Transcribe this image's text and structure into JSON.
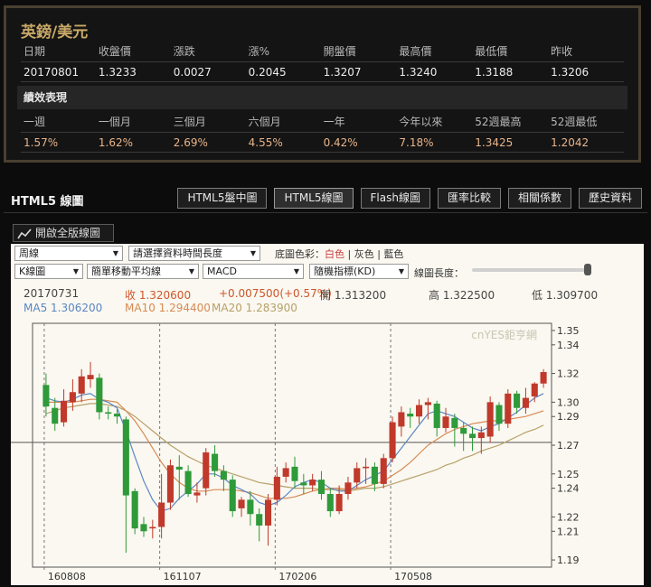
{
  "quote": {
    "title": "英鎊/美元",
    "headers": [
      "日期",
      "收盤價",
      "漲跌",
      "漲%",
      "開盤價",
      "最高價",
      "最低價",
      "昨收"
    ],
    "values": [
      "20170801",
      "1.3233",
      "0.0027",
      "0.2045",
      "1.3207",
      "1.3240",
      "1.3188",
      "1.3206"
    ],
    "perf_title": "績效表現",
    "perf_headers": [
      "一週",
      "一個月",
      "三個月",
      "六個月",
      "一年",
      "今年以來",
      "52週最高",
      "52週最低"
    ],
    "perf_values": [
      "1.57%",
      "1.62%",
      "2.69%",
      "4.55%",
      "0.42%",
      "7.18%",
      "1.3425",
      "1.2042"
    ]
  },
  "section": {
    "title": "HTML5 線圖",
    "tabs": [
      "HTML5盤中圖",
      "HTML5線圖",
      "Flash線圖",
      "匯率比較",
      "相關係數",
      "歷史資料"
    ],
    "active_tab": "HTML5線圖"
  },
  "full_version_label": "開啟全版線圖",
  "controls": {
    "period": "周線",
    "time_length": "請選擇資料時間長度",
    "bg_label": "底圖色彩：",
    "bg_white": "白色",
    "bg_sep1": "|",
    "bg_gray": "灰色",
    "bg_sep2": "|",
    "bg_blue": "藍色",
    "chart_type": "K線圖",
    "ma_type": "簡單移動平均線",
    "indicator1": "MACD",
    "indicator2": "隨機指標(KD)",
    "length_label": "線圖長度："
  },
  "info": {
    "date": "20170731",
    "close": "收 1.320600",
    "change": "+0.007500(+0.57%)",
    "open": "開 1.313200",
    "high": "高 1.322500",
    "low": "低 1.309700",
    "ma5": "MA5 1.306200",
    "ma10": "MA10 1.294400",
    "ma20": "MA20 1.283900"
  },
  "watermark": "cnYES鉅亨網",
  "colors": {
    "up": "#c0392b",
    "down": "#2e9a3a",
    "ma5": "#5b86c4",
    "ma10": "#d88a55",
    "ma20": "#b8a06a",
    "gold": "#c8a867"
  },
  "chart_data": {
    "type": "candlestick",
    "x_ticks": [
      "160808",
      "161107",
      "170206",
      "170508"
    ],
    "y_ticks": [
      1.35,
      1.34,
      1.32,
      1.3,
      1.29,
      1.27,
      1.25,
      1.24,
      1.22,
      1.21,
      1.19
    ],
    "ylim": [
      1.185,
      1.355
    ],
    "reference_line": 1.272,
    "candles": [
      {
        "o": 1.312,
        "c": 1.297,
        "h": 1.32,
        "l": 1.29
      },
      {
        "o": 1.296,
        "c": 1.285,
        "h": 1.303,
        "l": 1.28
      },
      {
        "o": 1.286,
        "c": 1.301,
        "h": 1.309,
        "l": 1.283
      },
      {
        "o": 1.3,
        "c": 1.307,
        "h": 1.316,
        "l": 1.294
      },
      {
        "o": 1.306,
        "c": 1.318,
        "h": 1.323,
        "l": 1.3
      },
      {
        "o": 1.316,
        "c": 1.319,
        "h": 1.328,
        "l": 1.31
      },
      {
        "o": 1.317,
        "c": 1.293,
        "h": 1.32,
        "l": 1.288
      },
      {
        "o": 1.293,
        "c": 1.292,
        "h": 1.297,
        "l": 1.288
      },
      {
        "o": 1.292,
        "c": 1.29,
        "h": 1.295,
        "l": 1.285
      },
      {
        "o": 1.288,
        "c": 1.235,
        "h": 1.29,
        "l": 1.195
      },
      {
        "o": 1.238,
        "c": 1.212,
        "h": 1.24,
        "l": 1.208
      },
      {
        "o": 1.215,
        "c": 1.21,
        "h": 1.22,
        "l": 1.206
      },
      {
        "o": 1.212,
        "c": 1.213,
        "h": 1.218,
        "l": 1.205
      },
      {
        "o": 1.213,
        "c": 1.23,
        "h": 1.25,
        "l": 1.205
      },
      {
        "o": 1.23,
        "c": 1.256,
        "h": 1.26,
        "l": 1.225
      },
      {
        "o": 1.255,
        "c": 1.253,
        "h": 1.263,
        "l": 1.232
      },
      {
        "o": 1.252,
        "c": 1.236,
        "h": 1.256,
        "l": 1.234
      },
      {
        "o": 1.235,
        "c": 1.237,
        "h": 1.244,
        "l": 1.23
      },
      {
        "o": 1.24,
        "c": 1.265,
        "h": 1.268,
        "l": 1.235
      },
      {
        "o": 1.264,
        "c": 1.252,
        "h": 1.27,
        "l": 1.248
      },
      {
        "o": 1.252,
        "c": 1.246,
        "h": 1.256,
        "l": 1.238
      },
      {
        "o": 1.246,
        "c": 1.224,
        "h": 1.249,
        "l": 1.22
      },
      {
        "o": 1.226,
        "c": 1.232,
        "h": 1.234,
        "l": 1.22
      },
      {
        "o": 1.232,
        "c": 1.222,
        "h": 1.238,
        "l": 1.214
      },
      {
        "o": 1.222,
        "c": 1.214,
        "h": 1.226,
        "l": 1.203
      },
      {
        "o": 1.214,
        "c": 1.232,
        "h": 1.236,
        "l": 1.2
      },
      {
        "o": 1.232,
        "c": 1.248,
        "h": 1.255,
        "l": 1.228
      },
      {
        "o": 1.248,
        "c": 1.254,
        "h": 1.258,
        "l": 1.244
      },
      {
        "o": 1.255,
        "c": 1.245,
        "h": 1.262,
        "l": 1.24
      },
      {
        "o": 1.244,
        "c": 1.242,
        "h": 1.25,
        "l": 1.236
      },
      {
        "o": 1.242,
        "c": 1.246,
        "h": 1.25,
        "l": 1.238
      },
      {
        "o": 1.246,
        "c": 1.236,
        "h": 1.252,
        "l": 1.232
      },
      {
        "o": 1.236,
        "c": 1.224,
        "h": 1.24,
        "l": 1.22
      },
      {
        "o": 1.224,
        "c": 1.236,
        "h": 1.242,
        "l": 1.222
      },
      {
        "o": 1.236,
        "c": 1.244,
        "h": 1.248,
        "l": 1.232
      },
      {
        "o": 1.244,
        "c": 1.254,
        "h": 1.258,
        "l": 1.24
      },
      {
        "o": 1.254,
        "c": 1.255,
        "h": 1.261,
        "l": 1.243
      },
      {
        "o": 1.255,
        "c": 1.243,
        "h": 1.258,
        "l": 1.238
      },
      {
        "o": 1.243,
        "c": 1.261,
        "h": 1.264,
        "l": 1.24
      },
      {
        "o": 1.261,
        "c": 1.286,
        "h": 1.29,
        "l": 1.258
      },
      {
        "o": 1.283,
        "c": 1.293,
        "h": 1.297,
        "l": 1.276
      },
      {
        "o": 1.292,
        "c": 1.29,
        "h": 1.296,
        "l": 1.282
      },
      {
        "o": 1.29,
        "c": 1.298,
        "h": 1.302,
        "l": 1.285
      },
      {
        "o": 1.298,
        "c": 1.3,
        "h": 1.303,
        "l": 1.288
      },
      {
        "o": 1.299,
        "c": 1.282,
        "h": 1.301,
        "l": 1.276
      },
      {
        "o": 1.282,
        "c": 1.29,
        "h": 1.296,
        "l": 1.279
      },
      {
        "o": 1.289,
        "c": 1.282,
        "h": 1.292,
        "l": 1.269
      },
      {
        "o": 1.282,
        "c": 1.278,
        "h": 1.286,
        "l": 1.266
      },
      {
        "o": 1.278,
        "c": 1.275,
        "h": 1.283,
        "l": 1.266
      },
      {
        "o": 1.275,
        "c": 1.279,
        "h": 1.283,
        "l": 1.264
      },
      {
        "o": 1.276,
        "c": 1.3,
        "h": 1.304,
        "l": 1.272
      },
      {
        "o": 1.298,
        "c": 1.285,
        "h": 1.3,
        "l": 1.28
      },
      {
        "o": 1.285,
        "c": 1.306,
        "h": 1.309,
        "l": 1.282
      },
      {
        "o": 1.306,
        "c": 1.296,
        "h": 1.308,
        "l": 1.292
      },
      {
        "o": 1.296,
        "c": 1.303,
        "h": 1.31,
        "l": 1.292
      },
      {
        "o": 1.304,
        "c": 1.313,
        "h": 1.314,
        "l": 1.3
      },
      {
        "o": 1.313,
        "c": 1.321,
        "h": 1.323,
        "l": 1.31
      }
    ],
    "ma5": [
      1.303,
      1.301,
      1.3,
      1.302,
      1.305,
      1.306,
      1.302,
      1.3,
      1.296,
      1.28,
      1.262,
      1.245,
      1.232,
      1.224,
      1.226,
      1.233,
      1.238,
      1.243,
      1.25,
      1.25,
      1.247,
      1.242,
      1.239,
      1.236,
      1.23,
      1.228,
      1.23,
      1.235,
      1.241,
      1.244,
      1.246,
      1.244,
      1.24,
      1.238,
      1.238,
      1.242,
      1.246,
      1.249,
      1.252,
      1.26,
      1.268,
      1.276,
      1.284,
      1.292,
      1.294,
      1.292,
      1.29,
      1.286,
      1.282,
      1.28,
      1.283,
      1.285,
      1.289,
      1.293,
      1.298,
      1.303,
      1.306
    ],
    "ma10": [
      1.3,
      1.3,
      1.3,
      1.3,
      1.301,
      1.302,
      1.302,
      1.301,
      1.3,
      1.294,
      1.287,
      1.278,
      1.268,
      1.258,
      1.25,
      1.244,
      1.24,
      1.238,
      1.238,
      1.239,
      1.239,
      1.239,
      1.238,
      1.237,
      1.235,
      1.233,
      1.233,
      1.233,
      1.234,
      1.236,
      1.238,
      1.239,
      1.24,
      1.24,
      1.239,
      1.24,
      1.241,
      1.243,
      1.245,
      1.249,
      1.253,
      1.258,
      1.264,
      1.27,
      1.274,
      1.278,
      1.281,
      1.283,
      1.285,
      1.286,
      1.287,
      1.287,
      1.288,
      1.289,
      1.29,
      1.292,
      1.294
    ],
    "ma20": [
      1.292,
      1.294,
      1.296,
      1.297,
      1.298,
      1.299,
      1.299,
      1.298,
      1.297,
      1.294,
      1.29,
      1.285,
      1.28,
      1.275,
      1.27,
      1.266,
      1.262,
      1.259,
      1.256,
      1.254,
      1.252,
      1.25,
      1.248,
      1.246,
      1.244,
      1.243,
      1.242,
      1.241,
      1.24,
      1.24,
      1.24,
      1.239,
      1.239,
      1.239,
      1.238,
      1.239,
      1.24,
      1.24,
      1.241,
      1.243,
      1.245,
      1.247,
      1.249,
      1.251,
      1.253,
      1.256,
      1.258,
      1.261,
      1.263,
      1.266,
      1.268,
      1.27,
      1.273,
      1.276,
      1.279,
      1.281,
      1.284
    ]
  }
}
